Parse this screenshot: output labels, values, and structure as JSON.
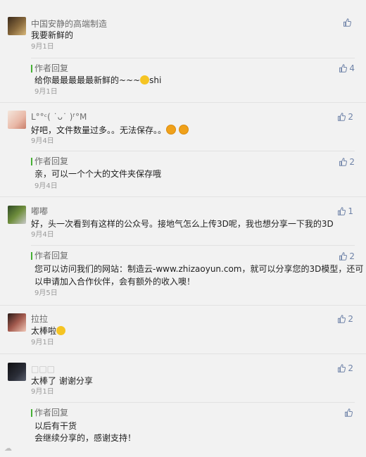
{
  "colors": {
    "accent_green": "#46b035",
    "like_blue": "#6f83a8",
    "meta_gray": "#9a9a9a"
  },
  "comments": [
    {
      "name": "中国安静的高端制造",
      "text": "我要新鲜的",
      "date": "9月1日",
      "likes": "",
      "reply": {
        "label": "作者回复",
        "text": "给你最最最最最新鲜的~~~",
        "text_suffix": "shi",
        "date": "9月1日",
        "likes": "4"
      }
    },
    {
      "name": "L°°ᶜ( ˙ᴗ˙ )ᶠ°M",
      "text": "好吧，文件数量过多。。无法保存。。",
      "date": "9月4日",
      "likes": "2",
      "reply": {
        "label": "作者回复",
        "text": "亲，可以一个个大的文件夹保存哦",
        "date": "9月4日",
        "likes": "2"
      }
    },
    {
      "name": "嘟嘟",
      "text": "好，头一次看到有这样的公众号。接地气怎么上传3D呢，我也想分享一下我的3D",
      "date": "9月4日",
      "likes": "1",
      "reply": {
        "label": "作者回复",
        "text_line1": "您可以访问我们的网站：制造云-www.zhizaoyun.com，就可以分享您的3D模型，还可",
        "text_line2": "以申请加入合作伙伴，会有额外的收入噢！",
        "date": "9月5日",
        "likes": "2"
      }
    },
    {
      "name": "拉拉",
      "text": "太棒啦",
      "date": "9月1日",
      "likes": "2"
    },
    {
      "name": "□□□",
      "text": "太棒了 谢谢分享",
      "date": "9月1日",
      "likes": "2",
      "reply": {
        "label": "作者回复",
        "text_line1": "以后有干货",
        "text_line2": "会继续分享的，感谢支持！",
        "likes": ""
      }
    }
  ],
  "icons": {
    "like": "thumbs-up-icon",
    "emoji": "smiley-icon"
  }
}
